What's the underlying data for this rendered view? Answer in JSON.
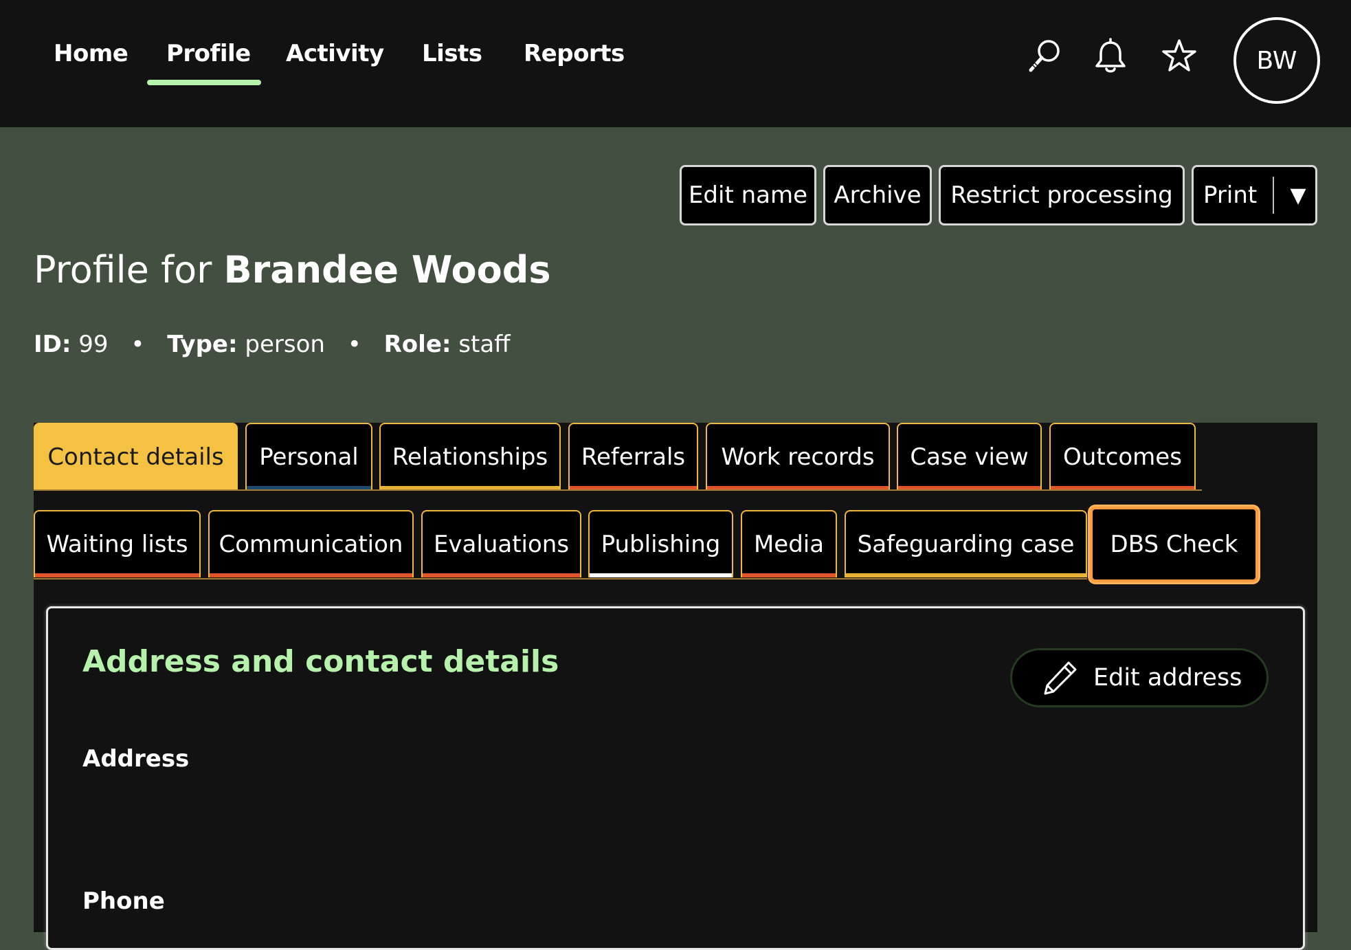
{
  "nav": {
    "items": [
      {
        "label": "Home"
      },
      {
        "label": "Profile"
      },
      {
        "label": "Activity"
      },
      {
        "label": "Lists"
      },
      {
        "label": "Reports"
      }
    ],
    "active": "Profile",
    "icons": [
      "search-icon",
      "bell-icon",
      "star-icon"
    ],
    "avatar_initials": "BW"
  },
  "actions": {
    "edit_name": "Edit name",
    "archive": "Archive",
    "restrict_processing": "Restrict processing",
    "print": "Print",
    "print_caret": "▼"
  },
  "profile": {
    "title_prefix": "Profile for",
    "name": "Brandee Woods",
    "meta": {
      "id_label": "ID:",
      "id_value": "99",
      "type_label": "Type:",
      "type_value": "person",
      "role_label": "Role:",
      "role_value": "staff",
      "separator": "•"
    }
  },
  "tabs": {
    "row1": [
      {
        "label": "Contact details"
      },
      {
        "label": "Personal"
      },
      {
        "label": "Relationships"
      },
      {
        "label": "Referrals"
      },
      {
        "label": "Work records"
      },
      {
        "label": "Case view"
      },
      {
        "label": "Outcomes"
      }
    ],
    "row2": [
      {
        "label": "Waiting lists"
      },
      {
        "label": "Communication"
      },
      {
        "label": "Evaluations"
      },
      {
        "label": "Publishing"
      },
      {
        "label": "Media"
      },
      {
        "label": "Safeguarding case"
      },
      {
        "label": "DBS Check"
      }
    ],
    "active": "Contact details",
    "focused": "DBS Check"
  },
  "card": {
    "title": "Address and contact details",
    "edit_button": "Edit address",
    "fields": [
      {
        "label": "Address"
      },
      {
        "label": "Phone"
      }
    ]
  },
  "colors": {
    "page_bg": "#434f40",
    "nav_bg": "#121212",
    "accent_green": "#b7f2ad",
    "tab_active": "#f5c142",
    "tab_border": "#f0b840",
    "focus_ring": "#ff9a3d"
  }
}
